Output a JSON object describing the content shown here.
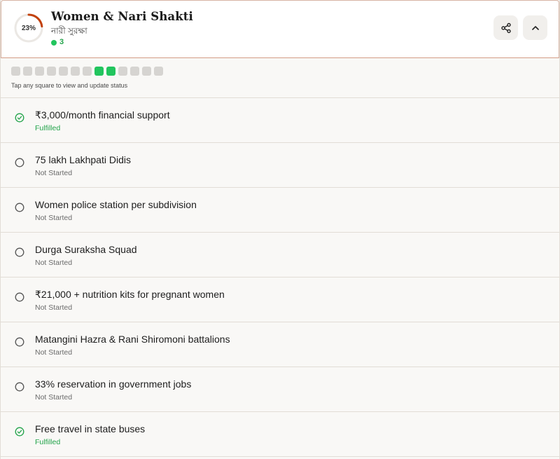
{
  "header": {
    "progress_text": "23%",
    "progress_fraction": 0.23,
    "title": "Women & Nari Shakti",
    "subtitle": "নারী সুরক্ষা",
    "count": "3",
    "share_icon": "share-icon",
    "collapse_icon": "chevron-up-icon"
  },
  "colors": {
    "accent_ring": "#c2410c",
    "fulfilled": "#22c55e",
    "not_started": "#d6d4d1"
  },
  "progress": {
    "squares": [
      "not_started",
      "not_started",
      "not_started",
      "not_started",
      "not_started",
      "not_started",
      "not_started",
      "fulfilled",
      "fulfilled",
      "not_started",
      "not_started",
      "not_started",
      "not_started"
    ],
    "hint": "Tap any square to view and update status"
  },
  "items": [
    {
      "label": "₹3,000/month financial support",
      "status": "Fulfilled",
      "done": true
    },
    {
      "label": "75 lakh Lakhpati Didis",
      "status": "Not Started",
      "done": false
    },
    {
      "label": "Women police station per subdivision",
      "status": "Not Started",
      "done": false
    },
    {
      "label": "Durga Suraksha Squad",
      "status": "Not Started",
      "done": false
    },
    {
      "label": "₹21,000 + nutrition kits for pregnant women",
      "status": "Not Started",
      "done": false
    },
    {
      "label": "Matangini Hazra & Rani Shiromoni battalions",
      "status": "Not Started",
      "done": false
    },
    {
      "label": "33% reservation in government jobs",
      "status": "Not Started",
      "done": false
    },
    {
      "label": "Free travel in state buses",
      "status": "Fulfilled",
      "done": true
    }
  ]
}
